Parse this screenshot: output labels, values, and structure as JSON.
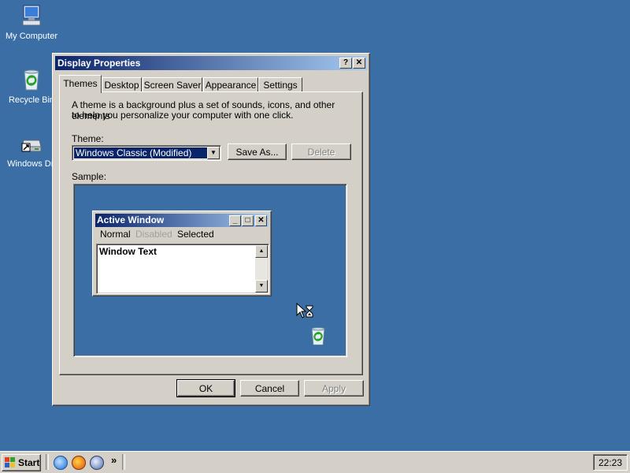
{
  "desktop": {
    "icons": [
      {
        "label": "My Computer",
        "icon": "my-computer-icon"
      },
      {
        "label": "Recycle Bin",
        "icon": "recycle-bin-icon"
      },
      {
        "label": "Windows Dri",
        "icon": "drive-shortcut-icon"
      }
    ]
  },
  "dialog": {
    "title": "Display Properties",
    "help_button": "?",
    "close_button": "✕",
    "tabs": [
      {
        "label": "Themes",
        "active": true
      },
      {
        "label": "Desktop"
      },
      {
        "label": "Screen Saver"
      },
      {
        "label": "Appearance"
      },
      {
        "label": "Settings"
      }
    ],
    "description_line1": "A theme is a background plus a set of sounds, icons, and other elements",
    "description_line2": "to help you personalize your computer with one click.",
    "theme_label": "Theme:",
    "theme_value": "Windows Classic (Modified)",
    "save_as_label": "Save As...",
    "delete_label": "Delete",
    "sample_label": "Sample:",
    "ok_label": "OK",
    "cancel_label": "Cancel",
    "apply_label": "Apply"
  },
  "sample": {
    "window_title": "Active Window",
    "menu": [
      "Normal",
      "Disabled",
      "Selected"
    ],
    "window_text": "Window Text"
  },
  "taskbar": {
    "start_label": "Start",
    "quick_launch": [
      "ie-icon",
      "firefox-icon",
      "browser-icon"
    ],
    "overflow": "»",
    "clock": "22:23"
  },
  "colors": {
    "desktop": "#3a6ea5",
    "title_active_start": "#0a246a",
    "title_active_end": "#a6caf0",
    "face": "#d4d0c8",
    "selection": "#0a246a"
  }
}
